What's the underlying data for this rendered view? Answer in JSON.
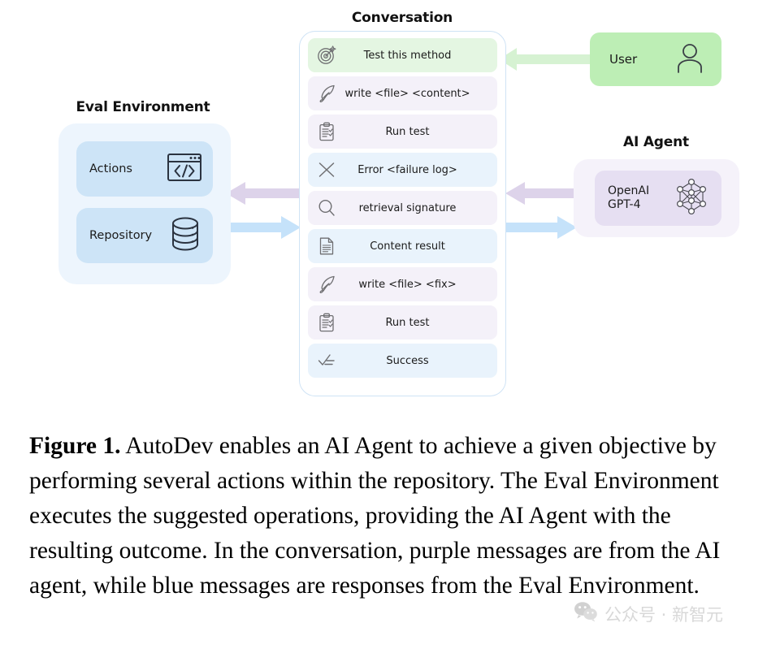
{
  "figure": {
    "eval_environment": {
      "title": "Eval Environment",
      "cards": [
        {
          "label": "Actions",
          "icon": "code-window-icon"
        },
        {
          "label": "Repository",
          "icon": "database-icon"
        }
      ]
    },
    "conversation": {
      "title": "Conversation",
      "messages": [
        {
          "icon": "target-icon",
          "text": "Test this method",
          "source": "user"
        },
        {
          "icon": "quill-icon",
          "text": "write <file> <content>",
          "source": "agent"
        },
        {
          "icon": "clipboard-icon",
          "text": "Run test",
          "source": "agent"
        },
        {
          "icon": "x-icon",
          "text": "Error <failure log>",
          "source": "env"
        },
        {
          "icon": "search-icon",
          "text": "retrieval signature",
          "source": "agent"
        },
        {
          "icon": "document-icon",
          "text": "Content result",
          "source": "env"
        },
        {
          "icon": "quill-icon",
          "text": "write <file> <fix>",
          "source": "agent"
        },
        {
          "icon": "clipboard-icon",
          "text": "Run test",
          "source": "agent"
        },
        {
          "icon": "check-list-icon",
          "text": "Success",
          "source": "env"
        }
      ]
    },
    "user": {
      "label": "User",
      "icon": "person-icon"
    },
    "ai_agent": {
      "title": "AI Agent",
      "model": "OpenAI\nGPT-4",
      "icon": "neural-network-icon"
    },
    "colors": {
      "user_green": "#bdeeb5",
      "message_user": "#e4f6e2",
      "message_agent": "#f4f1f9",
      "message_env": "#e9f3fc",
      "arrow_purple": "#ddd3ea",
      "arrow_blue": "#c5e2fa",
      "arrow_green": "#d6f2d2",
      "eval_outer": "#edf5fd",
      "eval_card": "#cde4f7",
      "agent_outer": "#f5f2fa",
      "agent_card": "#e6dff2"
    }
  },
  "caption": {
    "label": "Figure 1.",
    "text": " AutoDev enables an AI Agent to achieve a given objective by performing several actions within the repository. The Eval Environment executes the suggested operations, providing the AI Agent with the resulting outcome. In the conversation, purple messages are from the AI agent, while blue messages are responses from the Eval Environment."
  },
  "watermark": {
    "text": "公众号 · 新智元",
    "icon": "wechat-icon"
  }
}
